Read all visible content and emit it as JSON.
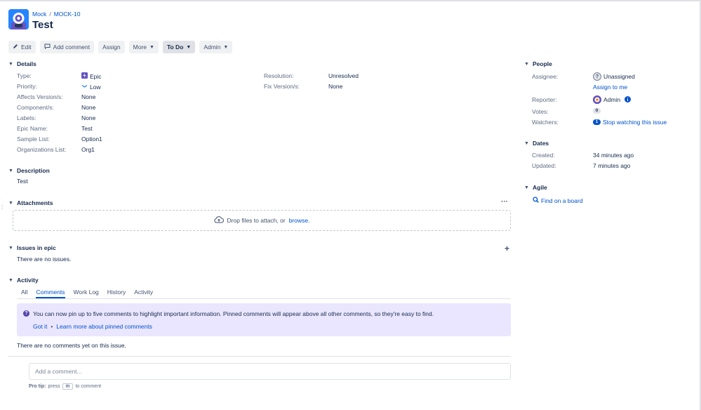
{
  "breadcrumb": {
    "project": "Mock",
    "separator": "/",
    "issue_key": "MOCK-10"
  },
  "title": "Test",
  "toolbar": {
    "edit": "Edit",
    "add_comment": "Add comment",
    "assign": "Assign",
    "more": "More",
    "status": "To Do",
    "admin": "Admin"
  },
  "details": {
    "heading": "Details",
    "left": [
      {
        "label": "Type:",
        "value": "Epic"
      },
      {
        "label": "Priority:",
        "value": "Low"
      },
      {
        "label": "Affects Version/s:",
        "value": "None"
      },
      {
        "label": "Component/s:",
        "value": "None"
      },
      {
        "label": "Labels:",
        "value": "None"
      },
      {
        "label": "Epic Name:",
        "value": "Test"
      },
      {
        "label": "Sample List:",
        "value": "Option1"
      },
      {
        "label": "Organizations List:",
        "value": "Org1"
      }
    ],
    "right": [
      {
        "label": "Resolution:",
        "value": "Unresolved"
      },
      {
        "label": "Fix Version/s:",
        "value": "None"
      }
    ]
  },
  "description": {
    "heading": "Description",
    "text": "Test"
  },
  "attachments": {
    "heading": "Attachments",
    "drop_text": "Drop files to attach, or",
    "browse": "browse."
  },
  "issues_in_epic": {
    "heading": "Issues in epic",
    "empty": "There are no issues."
  },
  "activity": {
    "heading": "Activity",
    "tabs": [
      "All",
      "Comments",
      "Work Log",
      "History",
      "Activity"
    ],
    "active_tab": "Comments",
    "info": "You can now pin up to five comments to highlight important information. Pinned comments will appear above all other comments, so they're easy to find.",
    "got_it": "Got it",
    "dot": "•",
    "learn_more": "Learn more about pinned comments",
    "empty": "There are no comments yet on this issue.",
    "comment_placeholder": "Add a comment...",
    "protip_label": "Pro tip:",
    "protip_press": "press",
    "protip_key": "m",
    "protip_suffix": "to comment"
  },
  "people": {
    "heading": "People",
    "assignee_label": "Assignee:",
    "assignee_value": "Unassigned",
    "assign_to_me": "Assign to me",
    "reporter_label": "Reporter:",
    "reporter_value": "Admin",
    "votes_label": "Votes:",
    "votes_value": "0",
    "watchers_label": "Watchers:",
    "watchers_count": "1",
    "watchers_action": "Stop watching this issue"
  },
  "dates": {
    "heading": "Dates",
    "created_label": "Created:",
    "created_value": "34 minutes ago",
    "updated_label": "Updated:",
    "updated_value": "7 minutes ago"
  },
  "agile": {
    "heading": "Agile",
    "find_board": "Find on a board"
  },
  "colors": {
    "link": "#0052cc",
    "epic": "#6554c0",
    "info_bg": "#eae6ff",
    "project_avatar": "#2684ff"
  }
}
